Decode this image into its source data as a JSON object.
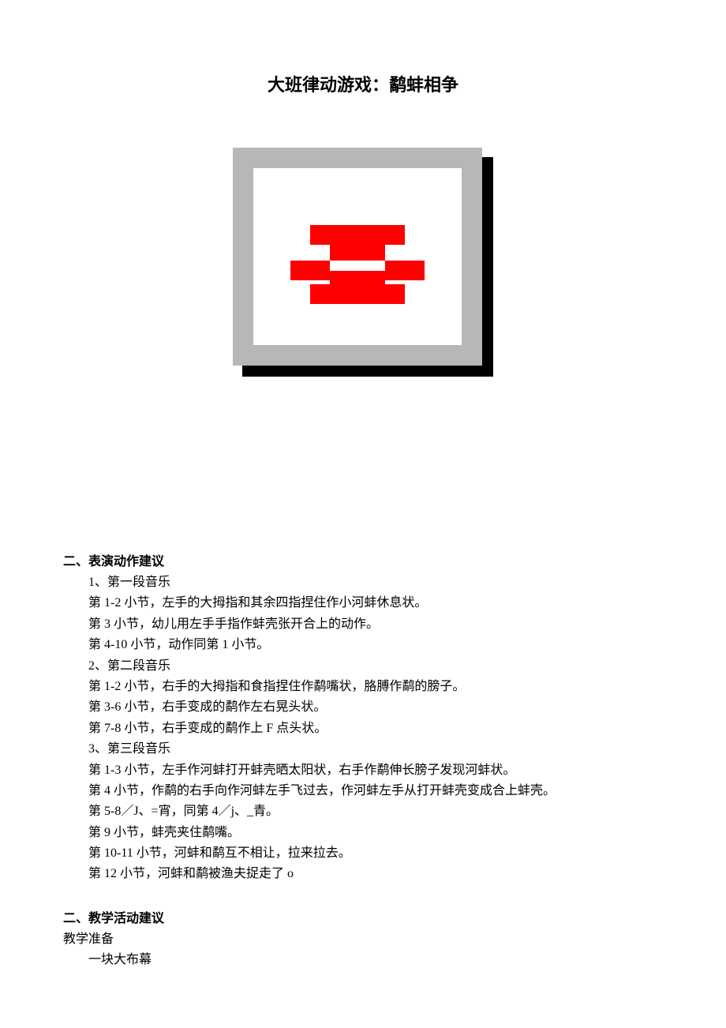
{
  "title": "大班律动游戏：鹬蚌相争",
  "section2_heading": "二、表演动作建议",
  "sec2": {
    "l1": "1、第一段音乐",
    "l2": "第 1-2 小节，左手的大拇指和其余四指捏住作小河蚌休息状。",
    "l3": "第 3 小节，幼儿用左手手指作蚌壳张开合上的动作。",
    "l4": "第 4-10 小节，动作同第 1 小节。",
    "l5": "2、第二段音乐",
    "l6": "第 1-2 小节，右手的大拇指和食指捏住作鹬嘴状，胳膊作鹬的膀子。",
    "l7": "第 3-6 小节，右手变成的鹬作左右晃头状。",
    "l8": "第 7-8 小节，右手变成的鹬作上 F 点头状。",
    "l9": "3、第三段音乐",
    "l10": "第 1-3 小节，左手作河蚌打开蚌壳晒太阳状，右手作鹬伸长膀子发现河蚌状。",
    "l11": "第 4 小节，作鹬的右手向作河蚌左手飞过去，作河蚌左手从打开蚌壳变成合上蚌壳。",
    "l12": "第 5-8／J、=宵，同第 4／j、_青。",
    "l13": "第 9 小节，蚌壳夹住鹬嘴。",
    "l14": "第 10-11 小节，河蚌和鹬互不相让，拉来拉去。",
    "l15": "第 12 小节，河蚌和鹬被渔夫捉走了 o"
  },
  "section3_heading": "二、教学活动建议",
  "prep_label": "教学准备",
  "prep_item1": "一块大布幕"
}
